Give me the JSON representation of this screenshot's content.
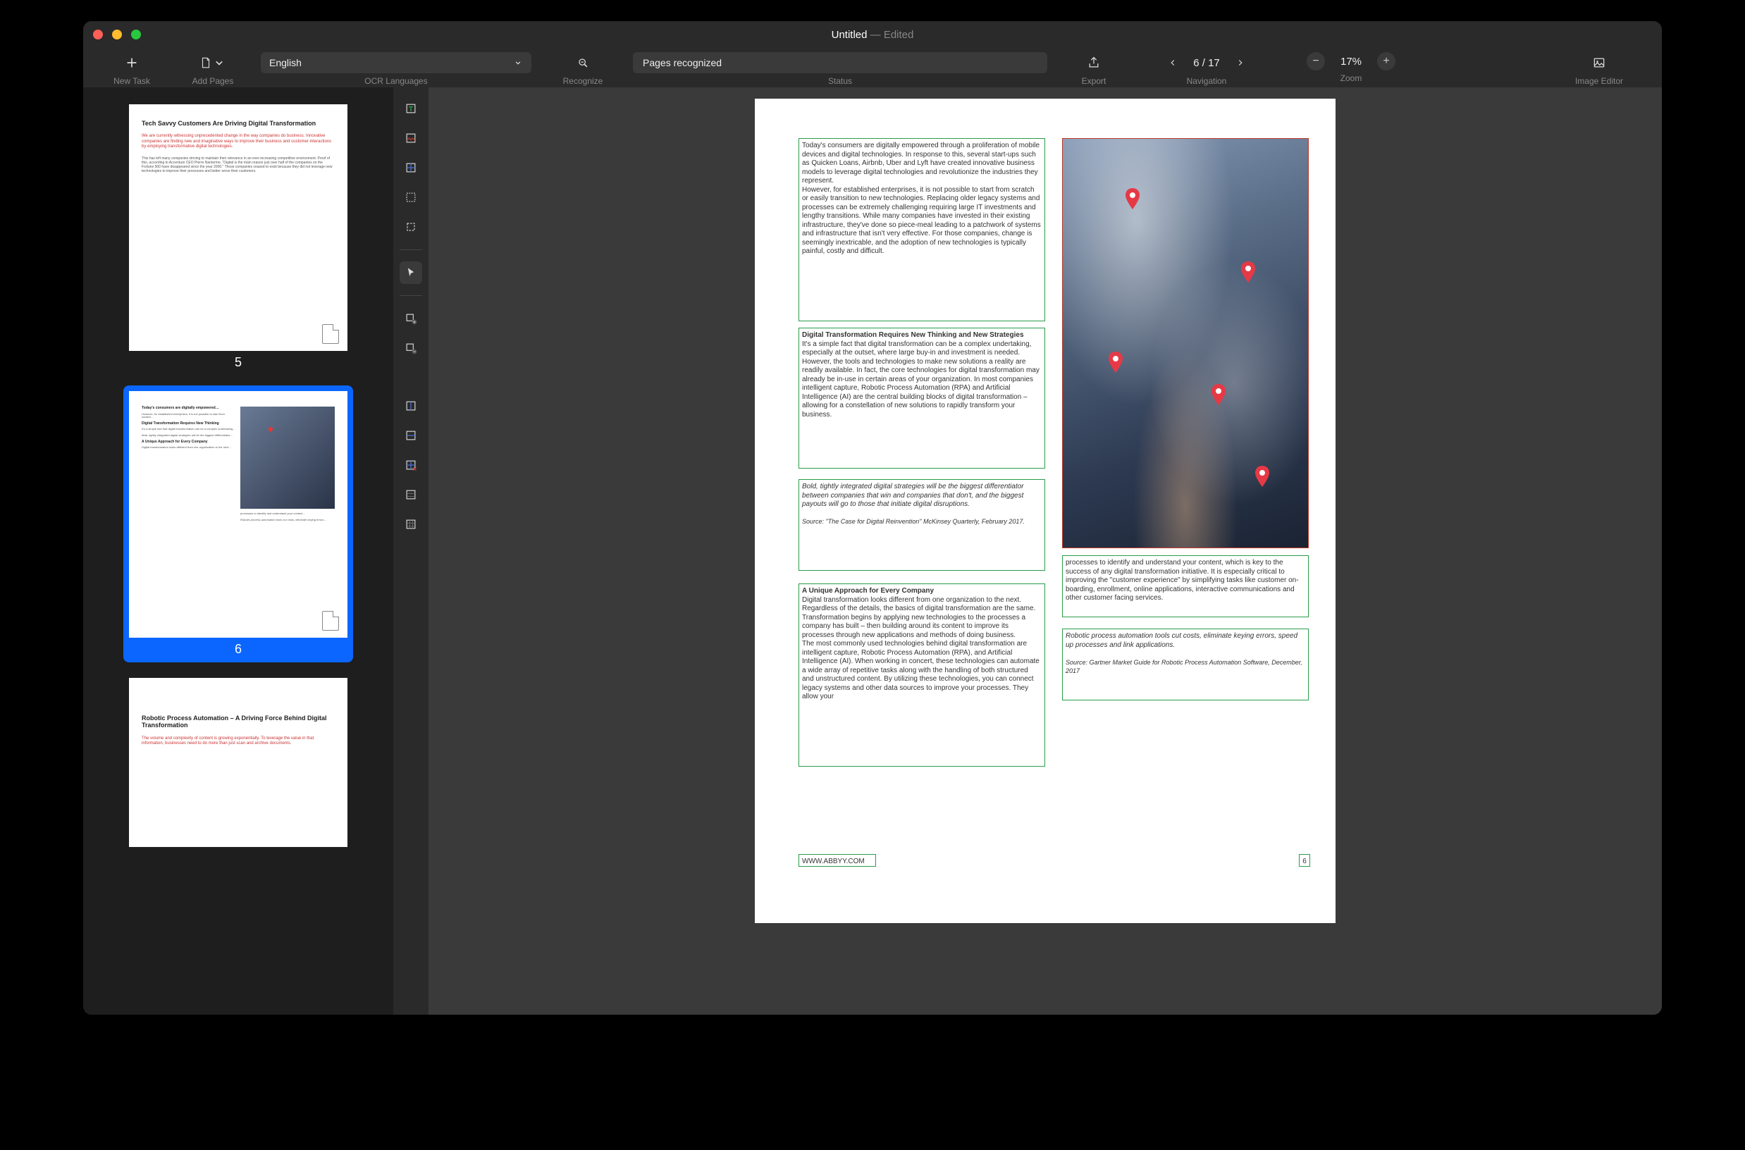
{
  "window": {
    "title": "Untitled",
    "subtitle": "Edited"
  },
  "toolbar": {
    "new_task": "New Task",
    "add_pages": "Add Pages",
    "ocr_languages": "OCR Languages",
    "language_value": "English",
    "recognize": "Recognize",
    "status_label": "Status",
    "status_value": "Pages recognized",
    "export": "Export",
    "navigation": "Navigation",
    "page_indicator": "6 / 17",
    "zoom": "Zoom",
    "zoom_value": "17%",
    "image_editor": "Image Editor"
  },
  "thumbnails": {
    "5": {
      "num": "5",
      "heading": "Tech Savvy Customers Are Driving Digital Transformation",
      "red": "We are currently witnessing unprecedented change in the way companies do business. Innovative companies are finding new and imaginative ways to improve their business and customer interactions by employing transformative digital technologies.",
      "body": "This has left many companies striving to maintain their relevance in an ever-increasing competitive environment. Proof of this, according to Accenture CEO Pierre Nanterme, \"Digital is the main reason just over half of the companies on the Fortune 500 have disappeared since the year 2000.\" Those companies ceased to exist because they did not leverage new technologies to improve their processes and better serve their customers."
    },
    "6": {
      "num": "6"
    },
    "7": {
      "num": "7",
      "heading": "Robotic Process Automation – A Driving Force Behind Digital Transformation",
      "red": "The volume and complexity of content is growing exponentially. To leverage the value in that information, businesses need to do more than just scan and archive documents."
    }
  },
  "page6": {
    "b1": "Today's consumers are digitally empowered through a proliferation of mobile devices and digital technologies. In response to this, several start-ups such as Quicken Loans, Airbnb, Uber and Lyft have created innovative business models to leverage digital technologies and revolutionize the industries they represent.\nHowever, for established enterprises, it is not possible to start from scratch or easily transition to new technologies. Replacing older legacy systems and processes can be extremely challenging requiring large IT investments and lengthy transitions. While many companies have invested in their existing infrastructure, they've done so piece-meal leading to a patchwork of systems and infrastructure that isn't very effective. For those companies, change is seemingly inextricable, and the adoption of new technologies is typically painful, costly and difficult.",
    "b2_hd": "Digital Transformation Requires New Thinking and New Strategies",
    "b2": "It's a simple fact that digital transformation can be a complex undertaking, especially at the outset, where large buy-in and investment is needed. However, the tools and technologies to make new solutions a reality are readily available. In fact, the core technologies for digital transformation may already be in-use in certain areas of your organization. In most companies intelligent capture, Robotic Process Automation (RPA) and Artificial Intelligence (AI) are the central building blocks of digital transformation – allowing for a constellation of new solutions to rapidly transform your business.",
    "b3": "Bold, tightly integrated digital strategies will be the biggest differentiator between companies that win and companies that don't, and the biggest payouts will go to those that initiate digital disruptions.",
    "b3_src": "Source: \"The Case for Digital Reinvention\" McKinsey Quarterly, February 2017.",
    "b4_hd": "A Unique Approach for Every Company",
    "b4": "Digital transformation looks different from one organization to the next. Regardless of the details, the basics of digital transformation are the same. Transformation begins by applying new technologies to the processes a company has built – then building around its content to improve its processes through new applications and methods of doing business.\nThe most commonly used technologies behind digital transformation are intelligent capture, Robotic Process Automation (RPA), and Artificial Intelligence (AI). When working in concert, these technologies can automate a wide array of repetitive tasks along with the handling of both structured and unstructured content. By utilizing these technologies, you can connect legacy systems and other data sources to improve your processes. They allow your",
    "b5": "processes to identify and understand your content, which is key to the success of any digital transformation initiative. It is especially critical to improving the \"customer experience\" by simplifying tasks like customer on-boarding, enrollment, online applications, interactive communications and other customer facing services.",
    "b6": "Robotic process automation tools cut costs, eliminate keying errors, speed up processes and link applications.",
    "b6_src": "Source: Gartner Market Guide for Robotic Process Automation Software, December, 2017",
    "footer_url": "WWW.ABBYY.COM",
    "footer_num": "6"
  }
}
